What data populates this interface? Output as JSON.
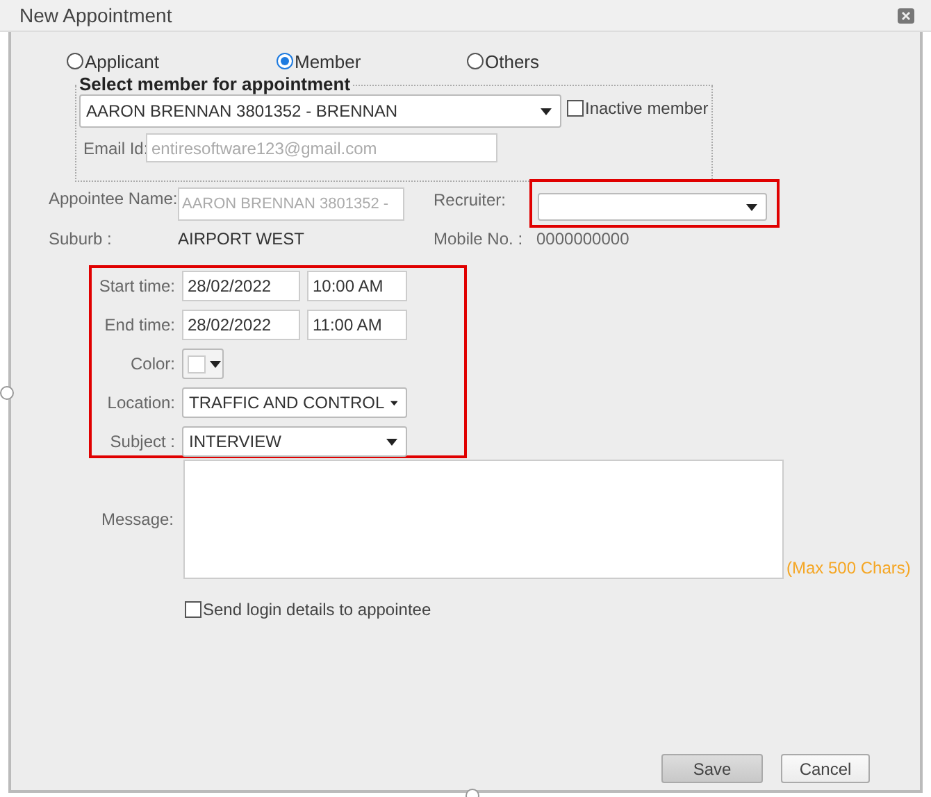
{
  "window": {
    "title": "New Appointment"
  },
  "appointee_types": [
    {
      "label": "Applicant",
      "selected": false
    },
    {
      "label": "Member",
      "selected": true
    },
    {
      "label": "Others",
      "selected": false
    }
  ],
  "member_section": {
    "legend": "Select member for appointment",
    "member": {
      "value": "AARON BRENNAN 3801352 - BRENNAN"
    },
    "inactive_member": {
      "label": "Inactive member",
      "checked": false
    },
    "email": {
      "label": "Email Id:",
      "value": "entiresoftware123@gmail.com"
    }
  },
  "appointee": {
    "name_label": "Appointee Name:",
    "name_value": "AARON BRENNAN 3801352 -",
    "suburb_label": "Suburb :",
    "suburb_value": "AIRPORT WEST"
  },
  "recruiter": {
    "label": "Recruiter:",
    "highlighted": true
  },
  "mobile": {
    "label": "Mobile No. :",
    "value": "0000000000"
  },
  "schedule": {
    "highlighted": true,
    "start": {
      "label": "Start time:",
      "date": "28/02/2022",
      "time": "10:00 AM"
    },
    "end": {
      "label": "End time:",
      "date": "28/02/2022",
      "time": "11:00 AM"
    },
    "color": {
      "label": "Color:"
    },
    "location": {
      "label": "Location:",
      "value": "TRAFFIC AND CONTROL"
    },
    "subject": {
      "label": "Subject :",
      "value": "INTERVIEW"
    }
  },
  "message": {
    "label": "Message:",
    "hint": "(Max 500 Chars)"
  },
  "send_login": {
    "label": "Send login details to appointee",
    "checked": false
  },
  "buttons": [
    {
      "label": "Save",
      "kind": "primary"
    },
    {
      "label": "Cancel",
      "kind": "secondary"
    }
  ]
}
